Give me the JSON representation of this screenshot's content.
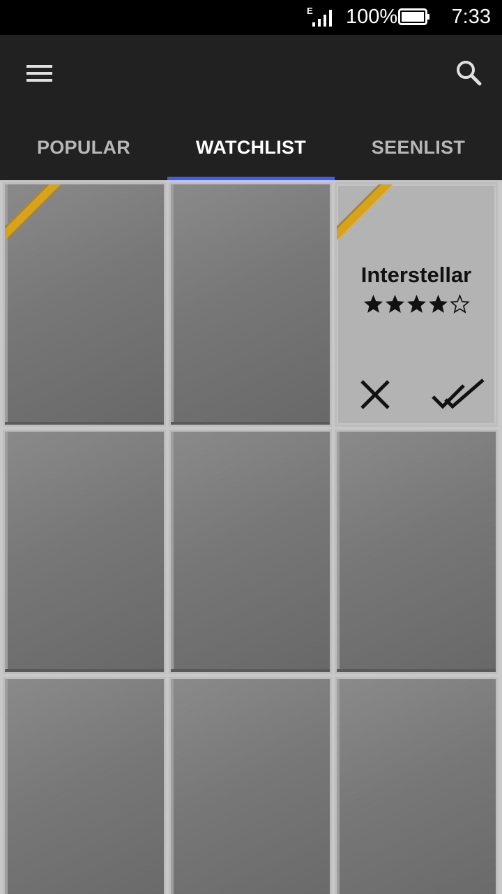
{
  "status_bar": {
    "network": "E",
    "battery_percent": "100%",
    "time": "7:33",
    "icons": [
      "signal-icon",
      "battery-icon"
    ]
  },
  "appbar": {
    "icons": [
      "menu-icon",
      "search-icon"
    ],
    "tabs": [
      {
        "label": "POPULAR",
        "active": false
      },
      {
        "label": "WATCHLIST",
        "active": true
      },
      {
        "label": "SEENLIST",
        "active": false
      }
    ],
    "accent_color": "#3d5afe"
  },
  "grid": {
    "ribbon_color": "#d9a21b",
    "detail_card": {
      "title": "Interstellar",
      "rating": 4,
      "rating_max": 5,
      "actions": [
        "close-icon",
        "double-check-icon"
      ]
    }
  }
}
